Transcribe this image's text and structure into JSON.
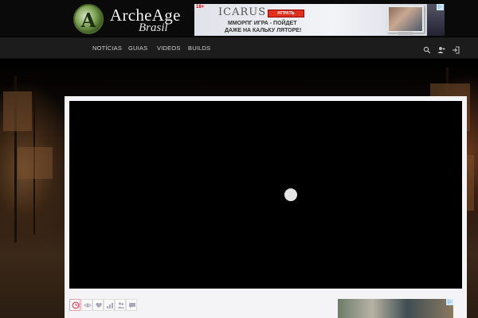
{
  "site": {
    "logo_title": "ArcheAge",
    "logo_sub": "Brasil",
    "logo_letter": "A"
  },
  "ad": {
    "age_rating": "18+",
    "brand": "ICARUS",
    "button_label": "ИГРАТЬ",
    "line1": "ММОРПГ ИГРА -   ПОЙДЕТ",
    "line2": "ДАЖЕ НА КАЛЬКУ  ЛЯТОРЕ!",
    "choices_icon": "adchoices-icon"
  },
  "nav": {
    "items": [
      {
        "label": "NOTÍCIAS"
      },
      {
        "label": "GUIAS"
      },
      {
        "label": "VIDEOS"
      },
      {
        "label": "BUILDS"
      }
    ],
    "icons": [
      "search-icon",
      "user-add-icon",
      "login-icon"
    ]
  },
  "video": {
    "state": "loading"
  },
  "toolbar": {
    "icons": [
      "clock-icon",
      "eye-icon",
      "heart-icon",
      "bar-chart-icon",
      "users-icon",
      "comment-icon"
    ],
    "active_index": 0,
    "active_color": "#e0405a"
  },
  "sidebar_ad": {
    "choices_icon": "adchoices-icon"
  }
}
